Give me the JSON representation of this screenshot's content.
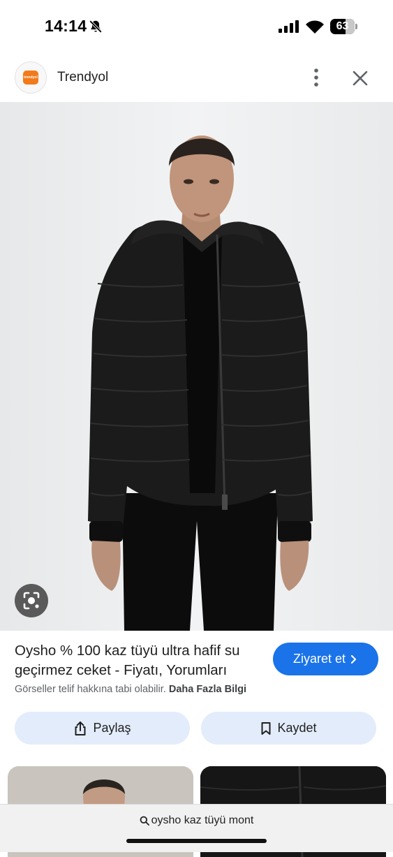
{
  "status_bar": {
    "time": "14:14",
    "battery": "63",
    "battery_fraction": 0.63
  },
  "header": {
    "site_name": "Trendyol",
    "logo_text": "trendyol"
  },
  "result": {
    "title": "Oysho % 100 kaz tüyü ultra hafif su geçirmez ceket - Fiyatı, Yorumları",
    "visit_label": "Ziyaret et",
    "disclaimer": "Görseller telif hakkına tabi olabilir.",
    "more_info_label": "Daha Fazla Bilgi"
  },
  "actions": {
    "share_label": "Paylaş",
    "save_label": "Kaydet"
  },
  "search": {
    "query": "oysho kaz tüyü mont"
  },
  "icons": [
    "bell-muted-icon",
    "signal-icon",
    "wifi-icon",
    "battery-icon",
    "more-vert-icon",
    "close-icon",
    "lens-icon",
    "chevron-right-icon",
    "share-icon",
    "bookmark-icon",
    "search-icon"
  ],
  "colors": {
    "accent": "#1a73e8",
    "pill_bg": "#e3ecfb",
    "brand": "#f27a1a"
  }
}
